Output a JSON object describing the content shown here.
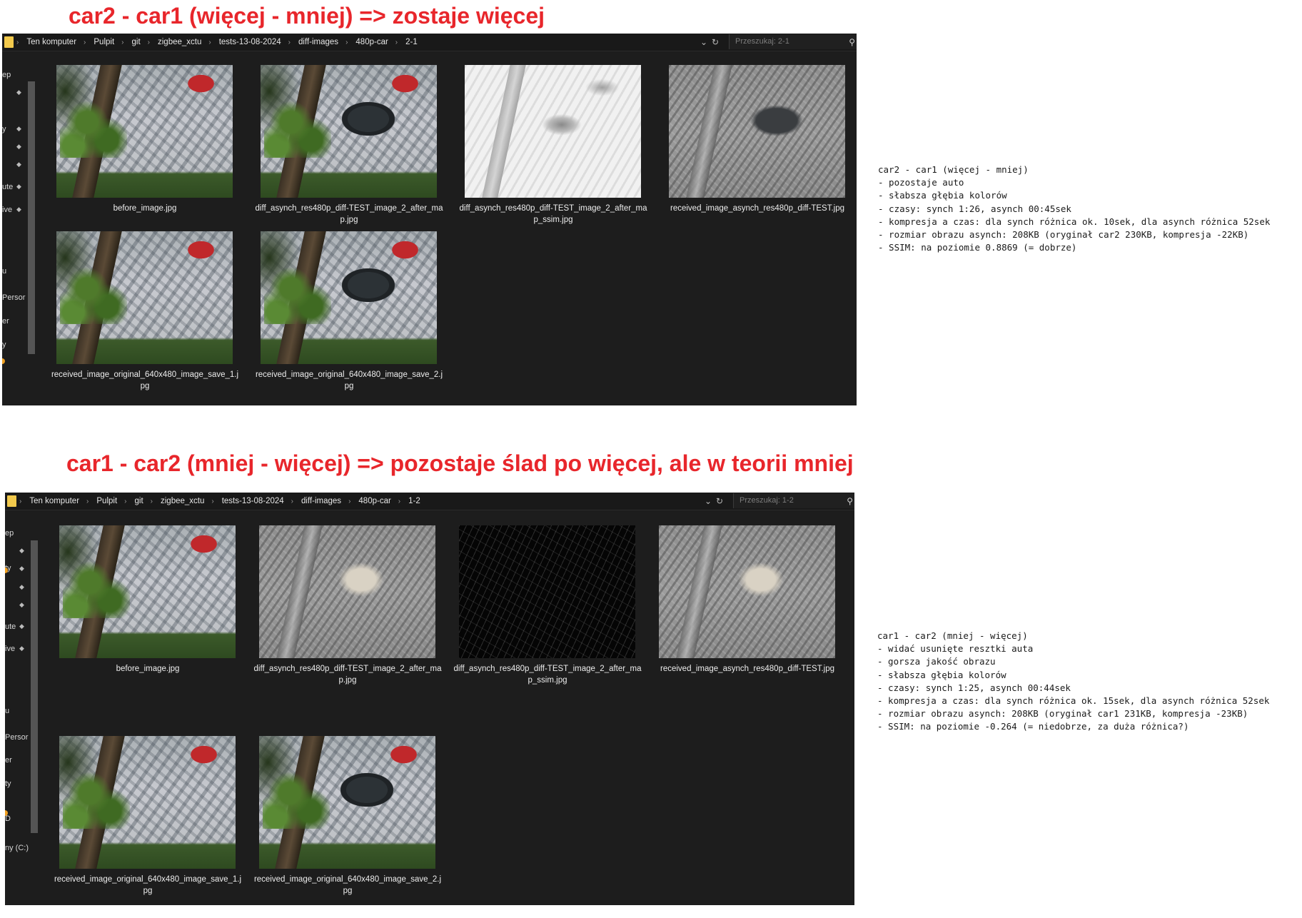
{
  "section1": {
    "heading": "car2 - car1 (więcej - mniej)  => zostaje więcej",
    "breadcrumbs": [
      "Ten komputer",
      "Pulpit",
      "git",
      "zigbee_xctu",
      "tests-13-08-2024",
      "diff-images",
      "480p-car",
      "2-1"
    ],
    "search_placeholder": "Przeszukaj: 2-1",
    "nav_items": [
      "ep",
      "y",
      "ute",
      "ive",
      "u",
      "Persor",
      "er",
      "y"
    ],
    "files": [
      {
        "name": "before_image.jpg",
        "kind": "photo-nocar"
      },
      {
        "name": "diff_asynch_res480p_diff-TEST_image_2_after_map.jpg",
        "kind": "photo-car"
      },
      {
        "name": "diff_asynch_res480p_diff-TEST_image_2_after_map_ssim.jpg",
        "kind": "ssim-white"
      },
      {
        "name": "received_image_asynch_res480p_diff-TEST.jpg",
        "kind": "diff-car"
      },
      {
        "name": "received_image_original_640x480_image_save_1.jpg",
        "kind": "photo-nocar"
      },
      {
        "name": "received_image_original_640x480_image_save_2.jpg",
        "kind": "photo-car"
      }
    ],
    "notes": [
      "car2 - car1 (więcej - mniej)",
      "- pozostaje auto",
      "- słabsza głębia kolorów",
      "- czasy: synch 1:26, asynch 00:45sek",
      "- kompresja a czas: dla synch różnica ok. 10sek, dla asynch różnica 52sek",
      "- rozmiar obrazu asynch: 208KB (oryginał car2 230KB, kompresja -22KB)",
      "- SSIM: na poziomie 0.8869 (= dobrze)"
    ]
  },
  "section2": {
    "heading": "car1 - car2 (mniej - więcej) => pozostaje ślad po więcej, ale w teorii mniej",
    "breadcrumbs": [
      "Ten komputer",
      "Pulpit",
      "git",
      "zigbee_xctu",
      "tests-13-08-2024",
      "diff-images",
      "480p-car",
      "1-2"
    ],
    "search_placeholder": "Przeszukaj: 1-2",
    "nav_items": [
      "ep",
      "ty",
      "ute",
      "ive",
      "u",
      "Persor",
      "er",
      "ty",
      "D",
      "ny (C:)"
    ],
    "files": [
      {
        "name": "before_image.jpg",
        "kind": "photo-nocar"
      },
      {
        "name": "diff_asynch_res480p_diff-TEST_image_2_after_map.jpg",
        "kind": "diff-patch"
      },
      {
        "name": "diff_asynch_res480p_diff-TEST_image_2_after_map_ssim.jpg",
        "kind": "ssim-black"
      },
      {
        "name": "received_image_asynch_res480p_diff-TEST.jpg",
        "kind": "diff-patch"
      },
      {
        "name": "received_image_original_640x480_image_save_1.jpg",
        "kind": "photo-nocar"
      },
      {
        "name": "received_image_original_640x480_image_save_2.jpg",
        "kind": "photo-car"
      }
    ],
    "notes": [
      "car1 - car2 (mniej - więcej)",
      "- widać usunięte resztki auta",
      "- gorsza jakość obrazu",
      "- słabsza głębia kolorów",
      "- czasy: synch 1:25, asynch 00:44sek",
      "- kompresja a czas: dla synch różnica ok. 15sek, dla asynch różnica 52sek",
      "- rozmiar obrazu asynch: 208KB (oryginał car1 231KB, kompresja -23KB)",
      "- SSIM: na poziomie -0.264 (= niedobrze, za duża różnica?)"
    ]
  },
  "icons": {
    "folder": "folder-icon",
    "chevron_right": "chevron-right-icon",
    "chevron_down": "chevron-down-icon",
    "refresh": "refresh-icon",
    "search": "search-icon",
    "pin": "pin-icon"
  },
  "colors": {
    "heading": "#e8262b",
    "explorer_bg": "#1d1d1d",
    "text_light": "#ededed"
  }
}
